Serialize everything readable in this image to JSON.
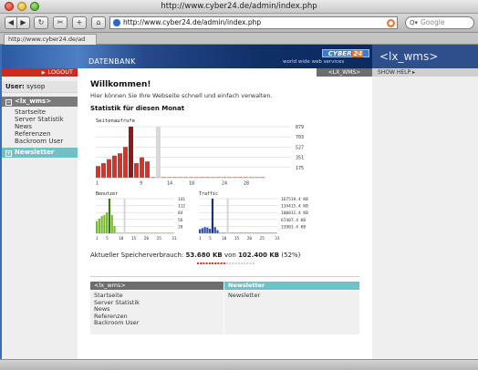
{
  "window": {
    "title": "http://www.cyber24.de/admin/index.php"
  },
  "toolbar": {
    "back": "◀",
    "forward": "▶",
    "reload": "↻",
    "screenshot": "✂",
    "add_bookmark": "+",
    "home": "⌂",
    "url": "http://www.cyber24.de/admin/index.php",
    "search_placeholder": "Google",
    "search_icon_label": "Q▾"
  },
  "tab": {
    "label": "http://www.cyber24.de/ad"
  },
  "banner": {
    "section_title": "DATENBANK",
    "logo_text": "CYBER",
    "logo_number": "24",
    "logo_subtitle": "world wide web services",
    "lx_title": "<lx_wms>"
  },
  "sidebar": {
    "logout": "LOGOUT",
    "user_label": "User:",
    "user_name": "sysop",
    "sections": [
      {
        "toggle": "−",
        "title": "<lx_wms>",
        "items": [
          "Startseite",
          "Server Statistik",
          "News",
          "Referenzen",
          "Backroom User"
        ]
      },
      {
        "toggle": "+",
        "title": "Newsletter",
        "items": []
      }
    ]
  },
  "top_tabs": {
    "lx_tab": "<LX_WMS>",
    "show_help": "SHOW HELP ▸"
  },
  "main": {
    "welcome": "Willkommen!",
    "intro": "Hier können Sie Ihre Webseite schnell und einfach verwalten.",
    "stats_title": "Statistik für diesen Monat",
    "storage_label": "Aktueller Speicherverbrauch:",
    "storage_used": "53.680 KB",
    "storage_of": "von",
    "storage_total": "102.400 KB",
    "storage_percent": "(52%)",
    "storage_fraction": 0.52
  },
  "bottom": {
    "col1_title": "<lx_wms>",
    "col1_items": [
      "Startseite",
      "Server Statistik",
      "News",
      "Referenzen",
      "Backroom User"
    ],
    "col2_title": "Newsletter",
    "col2_items": [
      "Newsletter"
    ]
  },
  "chart_data": [
    {
      "type": "bar",
      "title": "Seitenaufrufe",
      "x": [
        1,
        2,
        3,
        4,
        5,
        6,
        7,
        8,
        9,
        10,
        11,
        12,
        13,
        14,
        15,
        16,
        17,
        18,
        19,
        20,
        21,
        22,
        23,
        24,
        25,
        26,
        27,
        28,
        29,
        30,
        31
      ],
      "x_tick_labels": [
        "1",
        "9",
        "14",
        "18",
        "24",
        "28"
      ],
      "y_tick_labels": [
        "879",
        "703",
        "527",
        "351",
        "175"
      ],
      "values": [
        200,
        250,
        320,
        380,
        420,
        530,
        879,
        250,
        350,
        280,
        0,
        703,
        0,
        0,
        0,
        0,
        0,
        0,
        0,
        0,
        0,
        0,
        0,
        0,
        0,
        0,
        0,
        0,
        0,
        0,
        0
      ],
      "ylim": [
        0,
        879
      ],
      "colors": {
        "bars": "#d8322a",
        "highlight": "#8e1a17",
        "current": "#d8d8d8",
        "empty": "#e69a9a"
      },
      "highlight_index": 6,
      "current_index": 11
    },
    {
      "type": "bar",
      "title": "Benutzer",
      "x_tick_labels": [
        "1",
        "5",
        "10",
        "15",
        "20",
        "25",
        "31"
      ],
      "y_tick_labels": [
        "141",
        "112",
        "84",
        "56",
        "28"
      ],
      "values": [
        50,
        60,
        70,
        75,
        85,
        141,
        75,
        30,
        0,
        0,
        0,
        0,
        0,
        0,
        0,
        0,
        0,
        0,
        0,
        0,
        0,
        0,
        0,
        0,
        0,
        0,
        0,
        0,
        0,
        0,
        0
      ],
      "ylim": [
        0,
        141
      ],
      "colors": {
        "bars": "#76b82e",
        "highlight": "#3d7a12",
        "current": "#d8d8d8",
        "empty": "#b8d89a"
      },
      "highlight_index": 5,
      "current_index": 11
    },
    {
      "type": "bar",
      "title": "Traffic",
      "x_tick_labels": [
        "1",
        "5",
        "10",
        "15",
        "20",
        "25",
        "31"
      ],
      "y_tick_labels": [
        "167519.4 KB",
        "134415.4 KB",
        "100811.4 KB",
        "67407.4 KB",
        "33903.4 KB"
      ],
      "values": [
        20000,
        25000,
        30000,
        28000,
        22000,
        167519,
        30000,
        15000,
        0,
        0,
        0,
        0,
        0,
        0,
        0,
        0,
        0,
        0,
        0,
        0,
        0,
        0,
        0,
        0,
        0,
        0,
        0,
        0,
        0,
        0,
        0
      ],
      "ylim": [
        0,
        167519
      ],
      "colors": {
        "bars": "#2c4ea3",
        "highlight": "#17306e",
        "current": "#d8d8d8",
        "empty": "#9fb0d8"
      },
      "highlight_index": 5,
      "current_index": 11
    }
  ]
}
